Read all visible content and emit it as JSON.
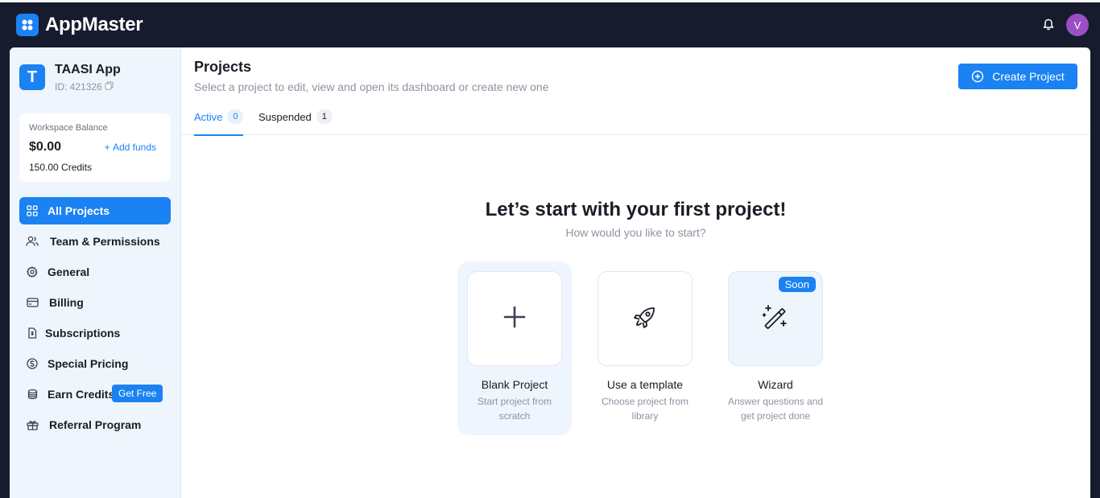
{
  "topbar": {
    "brand": "AppMaster",
    "avatar_letter": "V"
  },
  "workspace": {
    "avatar_letter": "T",
    "name": "TAASI App",
    "id": "ID: 421326",
    "balance": {
      "label": "Workspace Balance",
      "amount": "$0.00",
      "add_funds": "Add funds",
      "credits": "150.00 Credits"
    }
  },
  "sidebar": {
    "items": [
      {
        "label": "All Projects",
        "icon": "grid-icon",
        "active": true
      },
      {
        "label": "Team & Permissions",
        "icon": "users-icon"
      },
      {
        "label": "General",
        "icon": "gear-icon"
      },
      {
        "label": "Billing",
        "icon": "credit-card-icon"
      },
      {
        "label": "Subscriptions",
        "icon": "receipt-icon"
      },
      {
        "label": "Special Pricing",
        "icon": "dollar-circle-icon"
      },
      {
        "label": "Earn Credits",
        "icon": "coins-icon",
        "badge": "Get Free"
      },
      {
        "label": "Referral Program",
        "icon": "gift-icon"
      }
    ]
  },
  "main": {
    "title": "Projects",
    "subtitle": "Select a project to edit, view and open its dashboard or create new one",
    "create_label": "Create Project",
    "tabs": [
      {
        "label": "Active",
        "count": "0",
        "active": true
      },
      {
        "label": "Suspended",
        "count": "1"
      }
    ],
    "empty": {
      "title": "Let’s start with your first project!",
      "subtitle": "How would you like to start?"
    },
    "options": [
      {
        "title": "Blank Project",
        "desc": "Start project from scratch",
        "icon": "plus-icon"
      },
      {
        "title": "Use a template",
        "desc": "Choose project from library",
        "icon": "rocket-icon"
      },
      {
        "title": "Wizard",
        "desc": "Answer questions and get project done",
        "icon": "magic-wand-icon",
        "badge": "Soon"
      }
    ]
  },
  "colors": {
    "accent": "#1a82f2",
    "topbar": "#161b2e",
    "sidebar": "#eff5fc",
    "avatar": "#9b4fc4"
  }
}
